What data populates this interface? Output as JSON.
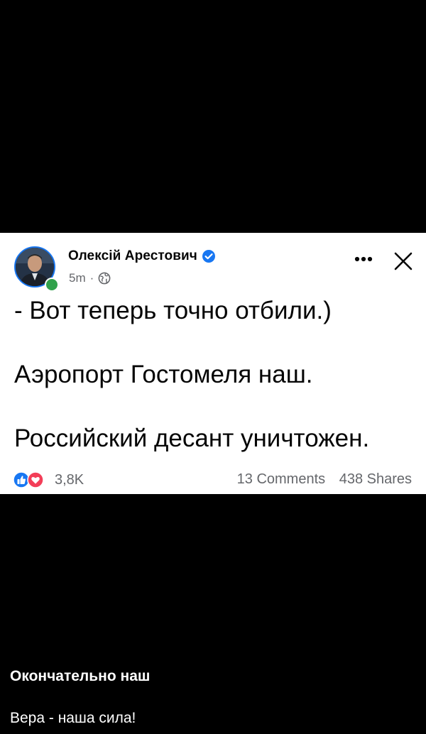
{
  "post": {
    "author_name": "Олексій Арестович",
    "timestamp": "5m",
    "meta_separator": "·",
    "visibility_icon": "globe-icon",
    "more_icon": "more-horizontal-icon",
    "close_icon": "close-icon",
    "text_lines": [
      "- Вот теперь точно отбили.)",
      "Аэропорт Гостомеля наш.",
      "Российский десант уничтожен."
    ],
    "reactions": {
      "icons": [
        "like-icon",
        "love-icon"
      ],
      "count": "3,8K"
    },
    "comments": "13 Comments",
    "shares": "438 Shares"
  },
  "caption": {
    "title": "Окончательно наш",
    "subtitle": "Вера - наша сила!"
  },
  "colors": {
    "background": "#000000",
    "card": "#ffffff",
    "text": "#050505",
    "secondary_text": "#65676b",
    "verified_blue": "#1877f2",
    "online_green": "#31a24c",
    "love_red": "#f33e58"
  }
}
